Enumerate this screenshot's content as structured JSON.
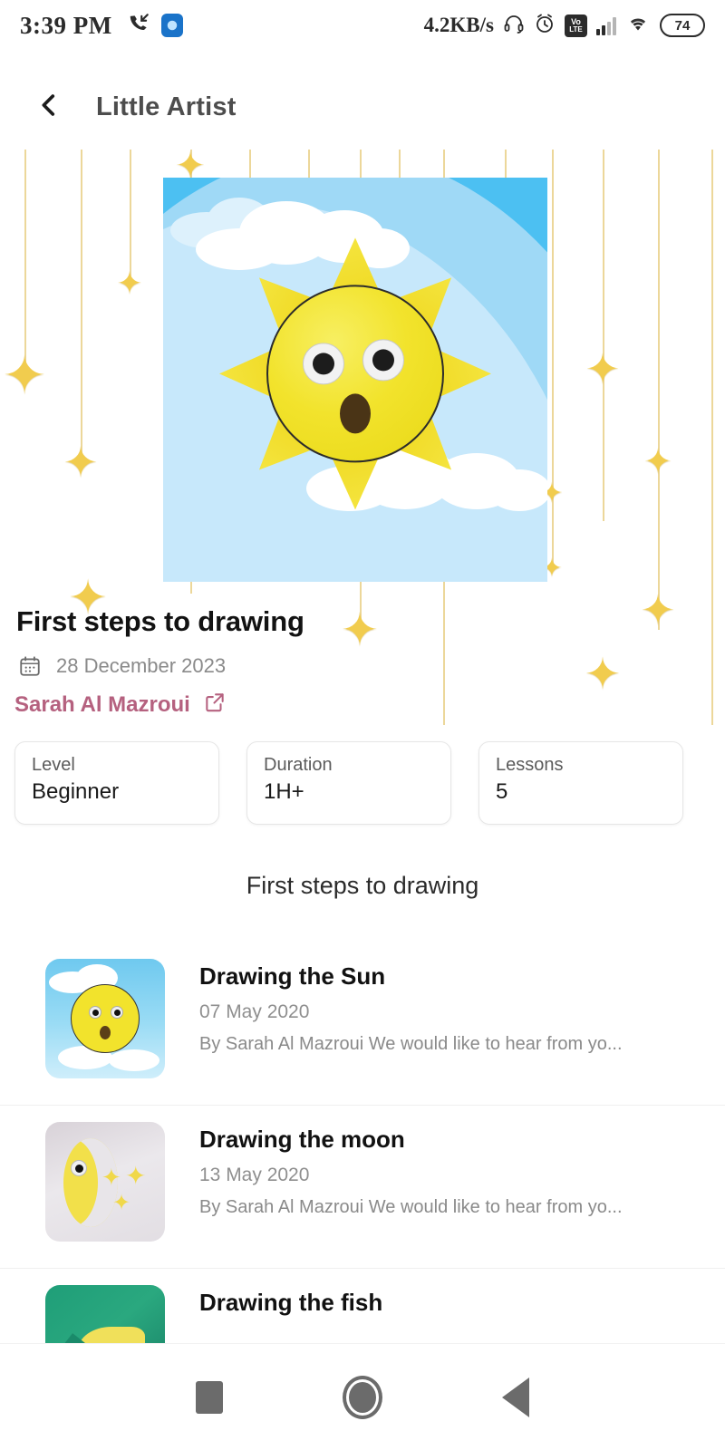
{
  "status_bar": {
    "time": "3:39 PM",
    "network_speed": "4.2KB/s",
    "battery_level": "74",
    "volte_top": "Vo",
    "volte_bottom": "LTE",
    "icons": [
      "missed-call-icon",
      "app-icon",
      "headphone-icon",
      "alarm-icon",
      "volte-icon",
      "signal-icon",
      "wifi-icon",
      "battery-icon"
    ]
  },
  "header": {
    "title": "Little Artist",
    "back_icon": "chevron-left-icon"
  },
  "course": {
    "title": "First steps to drawing",
    "date": "28 December 2023",
    "author": "Sarah Al Mazroui",
    "calendar_icon": "calendar-icon",
    "external_link_icon": "external-link-icon",
    "cards": [
      {
        "label": "Level",
        "value": "Beginner"
      },
      {
        "label": "Duration",
        "value": "1H+"
      },
      {
        "label": "Lessons",
        "value": "5"
      }
    ]
  },
  "lessons_section": {
    "heading": "First steps to drawing",
    "items": [
      {
        "title": "Drawing the Sun",
        "date": "07 May 2020",
        "description": "By Sarah Al Mazroui  We would like to hear from yo...",
        "thumb": "sun-craft-thumbnail"
      },
      {
        "title": "Drawing the moon",
        "date": "13 May 2020",
        "description": "By Sarah Al Mazroui  We would like to hear from yo...",
        "thumb": "moon-craft-thumbnail"
      },
      {
        "title": "Drawing the fish",
        "date": "",
        "description": "",
        "thumb": "fish-craft-thumbnail"
      }
    ]
  },
  "nav_bar": {
    "recents_label": "recents-button",
    "home_label": "home-button",
    "back_label": "back-button"
  },
  "colors": {
    "author_accent": "#b5617f",
    "star_gold": "#f1cc4e",
    "string_gold": "#ecd79a",
    "sky_blue": "#4cc0f2",
    "title_gray": "#4d4d4d"
  }
}
